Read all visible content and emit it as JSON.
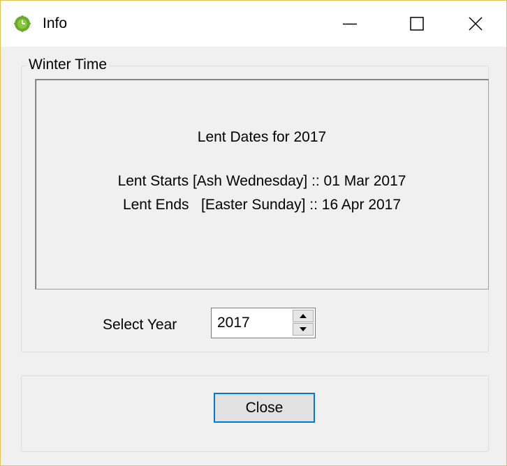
{
  "window": {
    "title": "Info"
  },
  "titlebar": {
    "icon": "clock-icon",
    "minimize_icon": "minimize-icon",
    "maximize_icon": "maximize-icon",
    "close_icon": "close-icon"
  },
  "group": {
    "legend": "Winter Time",
    "info_title": "Lent Dates for 2017",
    "lent_starts": "Lent Starts [Ash Wednesday] :: 01 Mar 2017",
    "lent_ends": "Lent Ends   [Easter Sunday] :: 16 Apr 2017"
  },
  "year_selector": {
    "label": "Select Year",
    "value": "2017",
    "up_icon": "spin-up-icon",
    "down_icon": "spin-down-icon"
  },
  "footer": {
    "close_label": "Close"
  },
  "colors": {
    "focus_border": "#0078d7",
    "window_bg": "#f0f0f0",
    "icon_green": "#6aaa2c"
  }
}
